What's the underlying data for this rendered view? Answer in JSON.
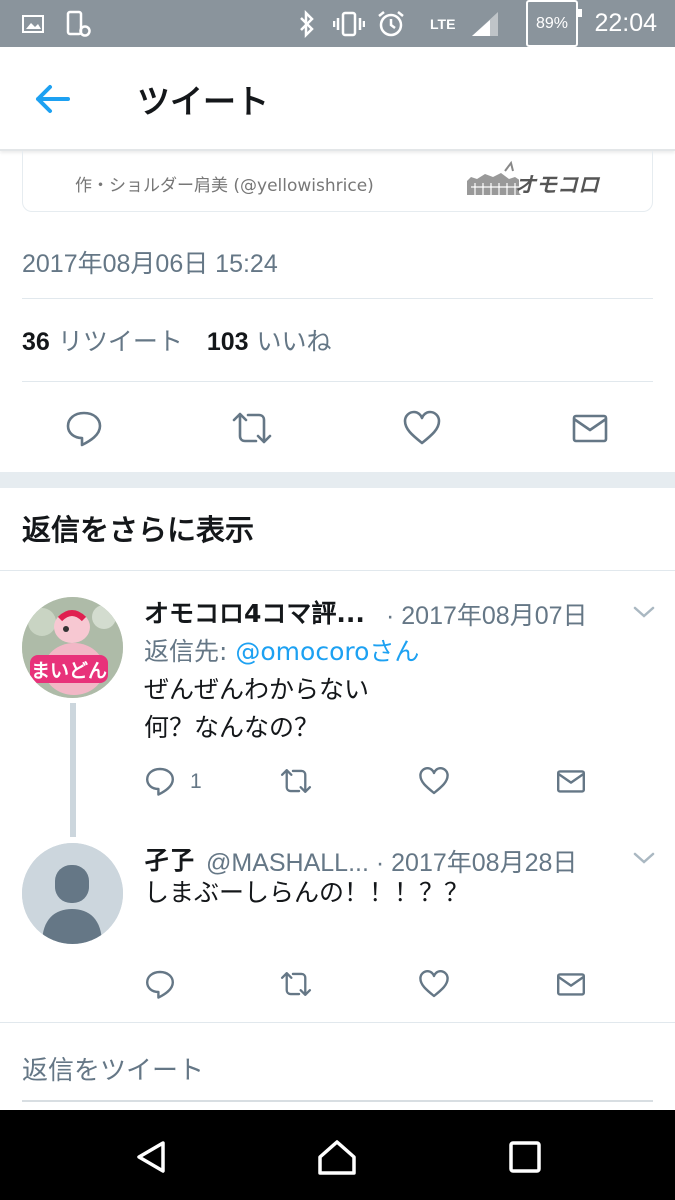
{
  "status_bar": {
    "time": "22:04",
    "battery": "89%",
    "network": "LTE",
    "icons": [
      "image-icon",
      "phone-settings-icon",
      "bluetooth-icon",
      "vibrate-icon",
      "alarm-icon",
      "signal-icon",
      "battery-icon"
    ]
  },
  "header": {
    "title": "ツイート",
    "back_icon": "back-arrow-icon"
  },
  "card": {
    "credit": "作・ショルダー肩美 (@yellowishrice)",
    "logo_text": "オモコロ"
  },
  "tweet": {
    "date": "2017年08月06日 15:24",
    "retweets_count": "36",
    "retweets_label": "リツイート",
    "likes_count": "103",
    "likes_label": "いいね"
  },
  "more_replies_label": "返信をさらに表示",
  "replies": [
    {
      "name": "オモコロ4コマ評...",
      "meta": "· 2017年08月07日",
      "reply_to_label": "返信先:",
      "reply_to_handle": "@omocoroさん",
      "text_lines": [
        "ぜんぜんわからない",
        "何？なんなの？"
      ],
      "reply_count": "1",
      "avatar_text": "まいどん"
    },
    {
      "name": "孑孒",
      "meta": "@MASHALL... · 2017年08月28日",
      "text_lines": [
        "しまぶーしらんの！！！？？"
      ]
    }
  ],
  "reply_placeholder": "返信をツイート",
  "colors": {
    "accent": "#1da1f2",
    "muted": "#657786",
    "status_bar": "#8a949c",
    "divider": "#e1e8ed"
  }
}
